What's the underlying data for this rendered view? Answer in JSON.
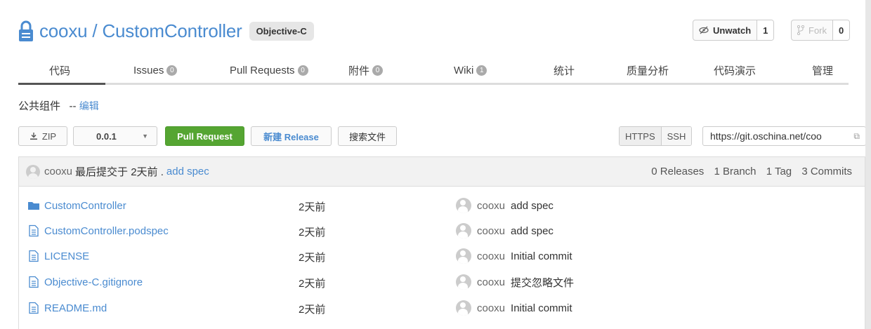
{
  "header": {
    "owner": "cooxu",
    "separator": " / ",
    "repo": "CustomController",
    "language": "Objective-C"
  },
  "watch": {
    "label": "Unwatch",
    "count": "1"
  },
  "fork": {
    "label": "Fork",
    "count": "0"
  },
  "tabs": [
    {
      "label": "代码",
      "badge": ""
    },
    {
      "label": "Issues",
      "badge": "0"
    },
    {
      "label": "Pull Requests",
      "badge": "0"
    },
    {
      "label": "附件",
      "badge": "0"
    },
    {
      "label": "Wiki",
      "badge": "1"
    },
    {
      "label": "统计",
      "badge": ""
    },
    {
      "label": "质量分析",
      "badge": ""
    },
    {
      "label": "代码演示",
      "badge": ""
    },
    {
      "label": "管理",
      "badge": ""
    }
  ],
  "description": {
    "text": "公共组件",
    "separator": "--",
    "edit_label": "编辑"
  },
  "toolbar": {
    "zip_label": "ZIP",
    "version": "0.0.1",
    "pull_request_label": "Pull Request",
    "new_release_label": "新建 Release",
    "search_files_label": "搜索文件",
    "https_label": "HTTPS",
    "ssh_label": "SSH",
    "clone_url": "https://git.oschina.net/coo"
  },
  "last_commit": {
    "author": "cooxu",
    "text": "最后提交于 2天前 .",
    "message": "add spec",
    "releases": "0 Releases",
    "branches": "1 Branch",
    "tags": "1 Tag",
    "commits": "3 Commits"
  },
  "files": [
    {
      "name": "CustomController",
      "type": "folder",
      "time": "2天前",
      "author": "cooxu",
      "message": "add spec"
    },
    {
      "name": "CustomController.podspec",
      "type": "file",
      "time": "2天前",
      "author": "cooxu",
      "message": "add spec"
    },
    {
      "name": "LICENSE",
      "type": "file",
      "time": "2天前",
      "author": "cooxu",
      "message": "Initial commit"
    },
    {
      "name": "Objective-C.gitignore",
      "type": "file",
      "time": "2天前",
      "author": "cooxu",
      "message": "提交忽略文件"
    },
    {
      "name": "README.md",
      "type": "file",
      "time": "2天前",
      "author": "cooxu",
      "message": "Initial commit"
    }
  ],
  "colors": {
    "link": "#4a8bd0",
    "green": "#55a532"
  }
}
